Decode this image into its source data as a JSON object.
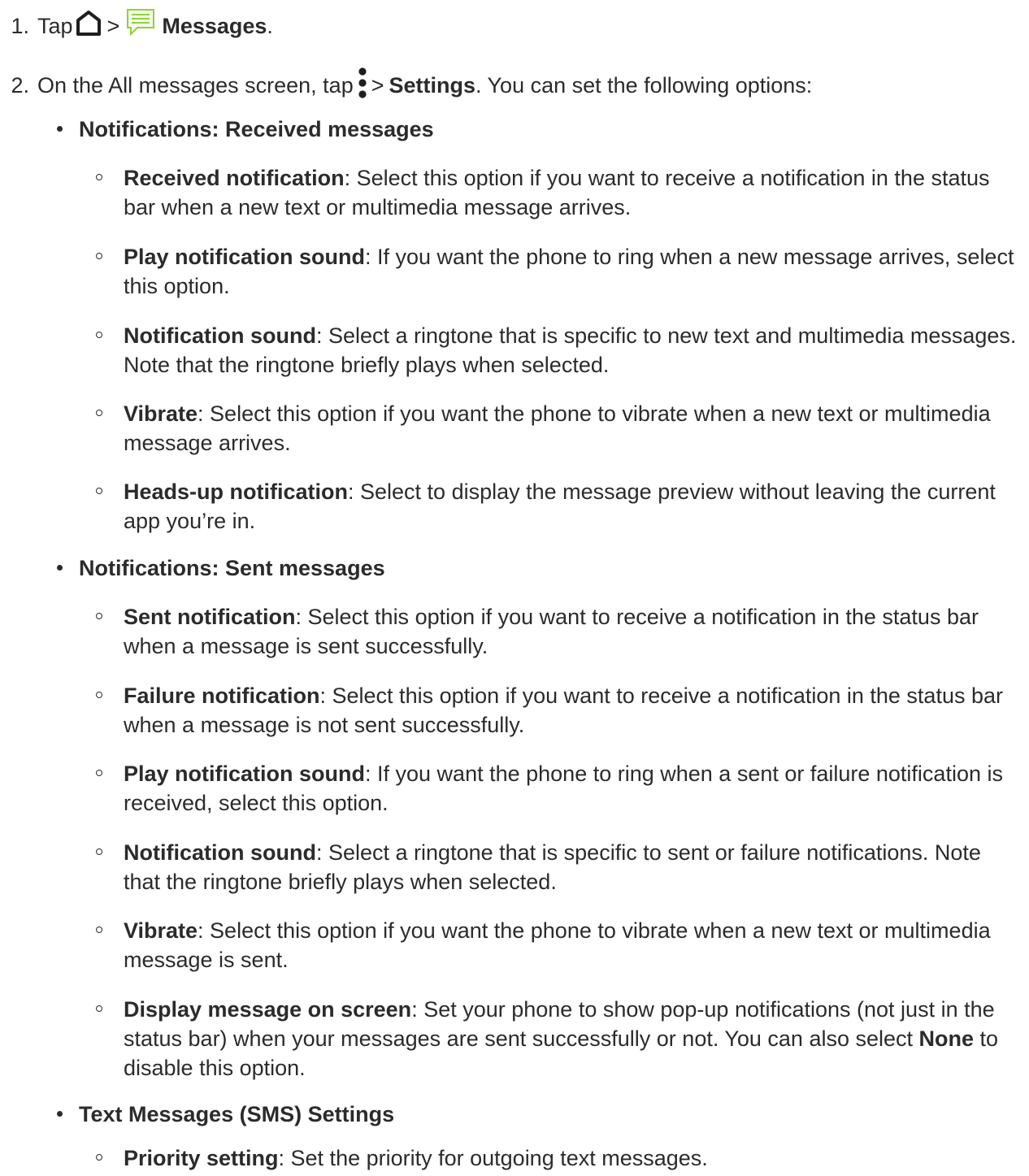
{
  "steps": [
    {
      "number": "1.",
      "parts": {
        "tap": "Tap",
        "sep1": ">",
        "app": "Messages",
        "end": "."
      },
      "icons": [
        "home-icon",
        "messages-app-icon"
      ]
    },
    {
      "number": "2.",
      "parts": {
        "lead": "On the All messages screen, tap",
        "sep1": ">",
        "settings": "Settings",
        "trail": ". You can set the following options:"
      },
      "icons": [
        "overflow-menu-icon"
      ]
    }
  ],
  "sections": [
    {
      "heading": "Notifications: Received messages",
      "items": [
        {
          "term": "Received notification",
          "text": ": Select this option if you want to receive a notification in the status bar when a new text or multimedia message arrives."
        },
        {
          "term": "Play notification sound",
          "text": ": If you want the phone to ring when a new message arrives, select this option."
        },
        {
          "term": "Notification sound",
          "text": ": Select a ringtone that is specific to new text and multimedia messages. Note that the ringtone briefly plays when selected."
        },
        {
          "term": "Vibrate",
          "text": ": Select this option if you want the phone to vibrate when a new text or multimedia message arrives."
        },
        {
          "term": "Heads-up notification",
          "text": ": Select to display the message preview without leaving the current app you’re in."
        }
      ]
    },
    {
      "heading": "Notifications: Sent messages",
      "items": [
        {
          "term": "Sent notification",
          "text": ": Select this option if you want to receive a notification in the status bar when a message is sent successfully."
        },
        {
          "term": "Failure notification",
          "text": ": Select this option if you want to receive a notification in the status bar when a message is not sent successfully."
        },
        {
          "term": "Play notification sound",
          "text": ": If you want the phone to ring when a sent or failure notification is received, select this option."
        },
        {
          "term": "Notification sound",
          "text": ": Select a ringtone that is specific to sent or failure notifications. Note that the ringtone briefly plays when selected."
        },
        {
          "term": "Vibrate",
          "text": ": Select this option if you want the phone to vibrate when a new text or multimedia message is sent."
        },
        {
          "term": "Display message on screen",
          "text": ": Set your phone to show pop-up notifications (not just in the status bar) when your messages are sent successfully or not. You can also select",
          "term2": "None",
          "text2": " to disable this option."
        }
      ]
    },
    {
      "heading": "Text Messages (SMS) Settings",
      "items": [
        {
          "term": "Priority setting",
          "text": ": Set the priority for outgoing text messages."
        }
      ]
    }
  ],
  "colors": {
    "text": "#2b2b2b",
    "messages_icon_green": "#8fd13f"
  }
}
